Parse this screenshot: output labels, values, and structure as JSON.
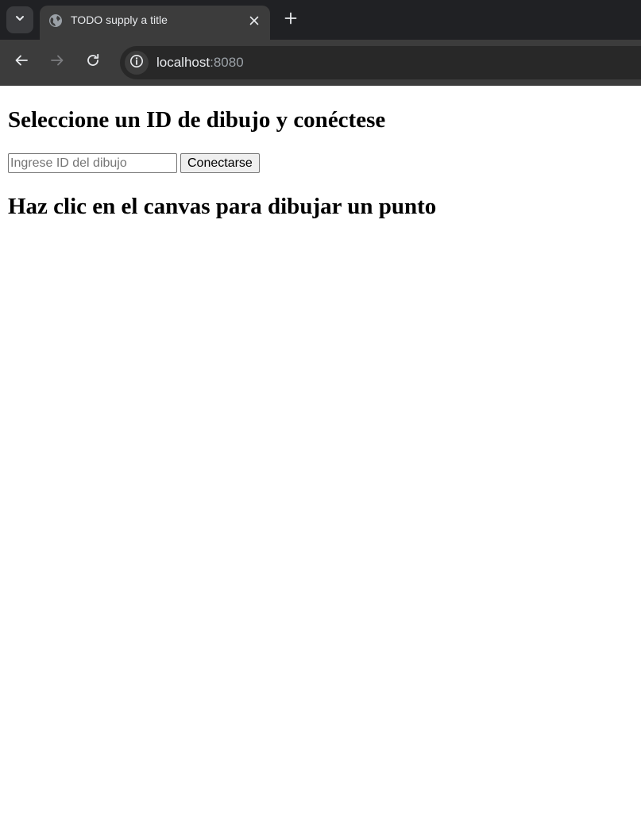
{
  "browser": {
    "tab": {
      "title": "TODO supply a title"
    },
    "address_bar": {
      "host": "localhost",
      "port": ":8080"
    }
  },
  "page": {
    "heading_select": "Seleccione un ID de dibujo y conéctese",
    "drawing_id_input": {
      "value": "",
      "placeholder": "Ingrese ID del dibujo"
    },
    "connect_button": "Conectarse",
    "heading_canvas": "Haz clic en el canvas para dibujar un punto"
  },
  "colors": {
    "tabstrip_bg": "#202124",
    "toolbar_bg": "#3c3c3c",
    "omnibox_bg": "#282828",
    "page_bg": "#ffffff"
  },
  "icons": [
    "chevron-down-icon",
    "globe-icon",
    "close-icon",
    "plus-icon",
    "back-arrow-icon",
    "forward-arrow-icon",
    "reload-icon",
    "info-icon"
  ]
}
